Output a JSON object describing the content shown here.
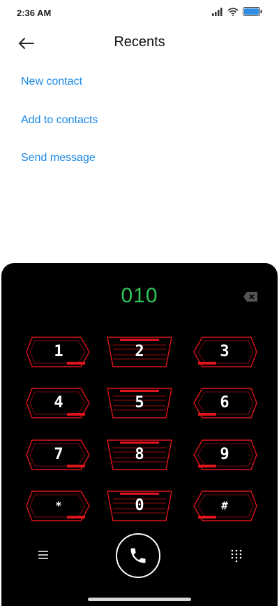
{
  "status_bar": {
    "time": "2:36 AM",
    "battery_color": "#2f8de4"
  },
  "header": {
    "title": "Recents",
    "back_icon": "arrow-left-icon"
  },
  "actions": [
    {
      "label": "New contact"
    },
    {
      "label": "Add to contacts"
    },
    {
      "label": "Send message"
    }
  ],
  "dialer": {
    "number": "010",
    "number_color": "#2fc55a",
    "accent_color": "#e0141a",
    "keys": [
      "1",
      "2",
      "3",
      "4",
      "5",
      "6",
      "7",
      "8",
      "9",
      "*",
      "0",
      "#"
    ]
  },
  "controls": {
    "menu_icon": "menu-icon",
    "call_icon": "phone-icon",
    "keypad_icon": "keypad-icon"
  }
}
